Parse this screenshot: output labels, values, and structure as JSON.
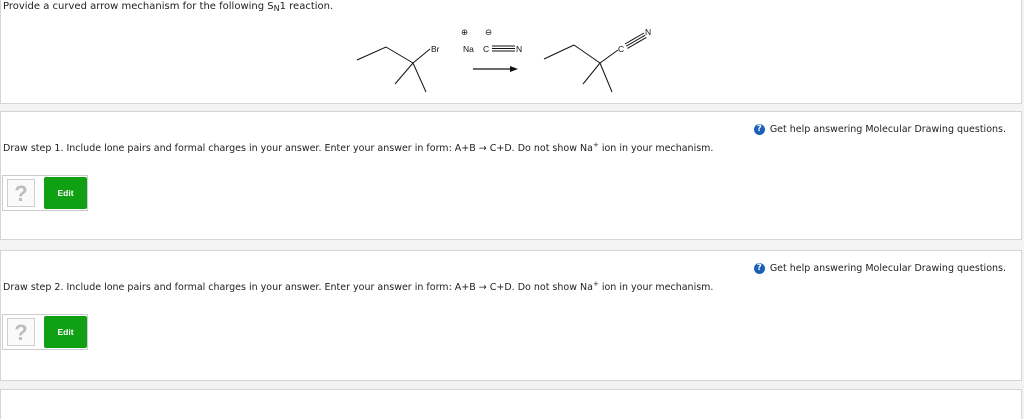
{
  "question": {
    "prompt_before": "Provide a curved arrow mechanism for the following S",
    "prompt_sub": "N",
    "prompt_after": "1 reaction."
  },
  "reaction": {
    "reactant_atom": "Br",
    "reagent_cation": "Na",
    "reagent_anion_c": "C",
    "reagent_anion_n": "N",
    "product_c": "C",
    "product_n": "N",
    "plus_charge": "⊕",
    "minus_charge": "⊖"
  },
  "steps": [
    {
      "help_icon": "?",
      "help_link": "Get help answering Molecular Drawing questions.",
      "text_before": "Draw step 1. Include lone pairs and formal charges in your answer. Enter your answer in form: A+B → C+D. Do not show Na",
      "text_sup": "+",
      "text_after": " ion in your mechanism.",
      "placeholder": "?",
      "edit_label": "Edit"
    },
    {
      "help_icon": "?",
      "help_link": "Get help answering Molecular Drawing questions.",
      "text_before": "Draw step 2. Include lone pairs and formal charges in your answer. Enter your answer in form: A+B → C+D. Do not show Na",
      "text_sup": "+",
      "text_after": " ion in your mechanism.",
      "placeholder": "?",
      "edit_label": "Edit"
    }
  ],
  "colors": {
    "edit_button": "#10a014",
    "help_icon": "#1b5fb8"
  }
}
